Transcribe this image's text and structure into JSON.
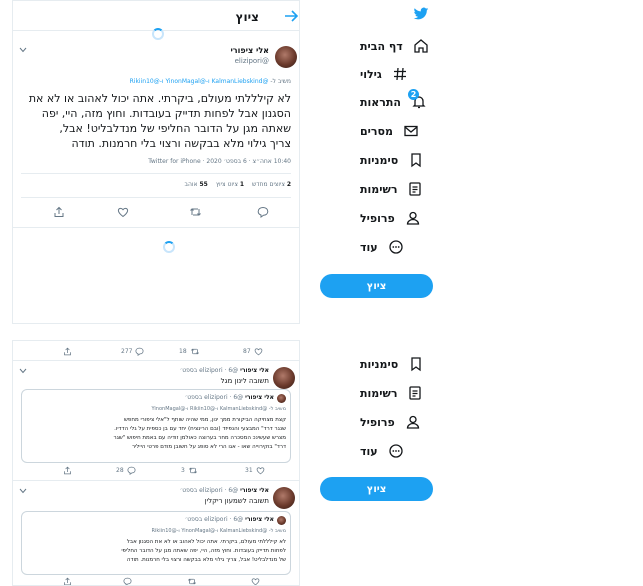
{
  "header": {
    "title": "ציוץ"
  },
  "nav": {
    "items": [
      {
        "label": "דף הבית",
        "icon": "home-icon"
      },
      {
        "label": "גילוי",
        "icon": "hashtag-icon"
      },
      {
        "label": "התראות",
        "icon": "bell-icon",
        "badge": "2"
      },
      {
        "label": "מסרים",
        "icon": "mail-icon"
      },
      {
        "label": "סימניות",
        "icon": "bookmark-icon"
      },
      {
        "label": "רשימות",
        "icon": "list-icon"
      },
      {
        "label": "פרופיל",
        "icon": "person-icon"
      },
      {
        "label": "עוד",
        "icon": "more-icon"
      }
    ],
    "tweet_button": "ציוץ"
  },
  "nav2": {
    "items": [
      {
        "label": "סימניות"
      },
      {
        "label": "רשימות"
      },
      {
        "label": "פרופיל"
      },
      {
        "label": "עוד"
      }
    ],
    "tweet_button": "ציוץ"
  },
  "tweet": {
    "author_name": "אלי ציפורי",
    "author_handle": "@elizipori",
    "reply_to_prefix": "משיב ל-",
    "reply_to_users": "@KalmanLiebskind ו-@YinonMagal ו-@Rikiin10",
    "text_lines": [
      "לא קילללתי מעולם, ביקרתי. אתה יכול לאהוב או לא את",
      "הסגנון אבל לפחות תדייק בעובדות. וחוץ מזה, היי, יפה",
      "שאתה מגן על הדובר החליפי של מנדלבליט! אבל,",
      "צריך גילוי מלא בבקשה ורצוי בלי חרמנות. תודה"
    ],
    "meta": "10:40 אחה״צ · 6 בספט׳ 2020 · Twitter for iPhone",
    "stats": {
      "retweets_count": "2",
      "retweets_label": "ציוצים מחדש",
      "quotes_count": "1",
      "quotes_label": "ציוט ציוץ",
      "likes_count": "55",
      "likes_label": "אוהב"
    }
  },
  "lower": {
    "top_actions": {
      "likes": "87",
      "retweets": "18",
      "replies": "277"
    },
    "reply1": {
      "author": "אלי ציפורי",
      "meta": "@elizipori · 6 בספט׳",
      "text": "תשובה לינון מגל",
      "quote_author": "אלי ציפורי",
      "quote_meta": "@elizipori · 6 בספט׳",
      "quote_reply_to": "משיב ל- @KalmanLiebskind ו-@Rikiin10 ו-@YinonMagal",
      "quote_lines": [
        "קצת מצחיקה הביקורת ממך ינון, ממי שהיה שותף ל\"אלי ציפורי מחפש",
        "שנגר דרד\" המבצעי והנפיזד (ובם הרינציח) יחד עם בן כספית על גלי הדדיו.",
        "מצרש שעשינכ המסכרה מחר בערוצה כאולמן זודיה עם באמת חיפוש \"שגר",
        "דרד\" בוקירוייה שאו - אגו הרי לא סופג על חשובן מודם פרטי הייליר"
      ],
      "actions": {
        "likes": "31",
        "retweets": "3",
        "replies": "28"
      }
    },
    "reply2": {
      "author": "אלי ציפורי",
      "meta": "@elizipori · 6 בספט׳",
      "text": "תשובה לשמעון ריקלין",
      "quote_author": "אלי ציפורי",
      "quote_meta": "@elizipori · 6 בספט׳",
      "quote_reply_to": "משיב ל- @KalmanLiebskind ו-@YinonMagal ו-@Rikiin10",
      "quote_lines": [
        "לא קילללתי מעולם, ביקרתי. אתה יכול לאהוב או לא את הסגנון אבל",
        "לפחות תדייק בעובדות. וחוץ מזה, היי, יפה שאתה מגן על הדובר החליפי",
        "של מנדלבליט! אבל, צריך גילוי מלא בבקשה ורצוי בלי חרמנות. תודה"
      ],
      "actions": {
        "likes": "",
        "retweets": "",
        "replies": ""
      }
    }
  },
  "colors": {
    "accent": "#1da1f2",
    "text": "#14171a",
    "muted": "#657786",
    "border": "#e6ecf0"
  }
}
